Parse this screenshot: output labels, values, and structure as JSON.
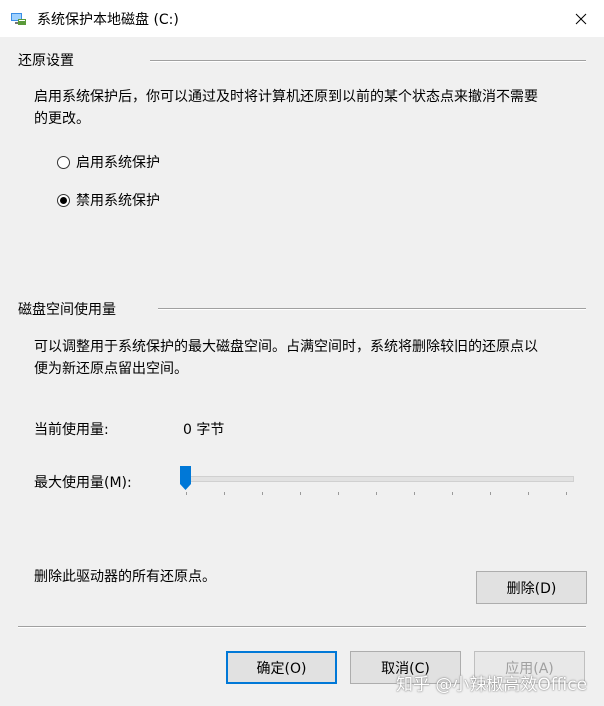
{
  "window": {
    "title": "系统保护本地磁盘 (C:)"
  },
  "restore": {
    "group_label": "还原设置",
    "description_line1": "启用系统保护后，你可以通过及时将计算机还原到以前的某个状态点来撤消不需要",
    "description_line2": "的更改。",
    "options": [
      {
        "label": "启用系统保护",
        "checked": false
      },
      {
        "label": "禁用系统保护",
        "checked": true
      }
    ]
  },
  "disk": {
    "group_label": "磁盘空间使用量",
    "description_line1": "可以调整用于系统保护的最大磁盘空间。占满空间时，系统将删除较旧的还原点以",
    "description_line2": "便为新还原点留出空间。",
    "current_usage_label": "当前使用量:",
    "current_usage_value": "0 字节",
    "max_usage_label": "最大使用量(M):",
    "max_usage_slider_fraction": 0
  },
  "delete": {
    "text": "删除此驱动器的所有还原点。",
    "button_label": "删除(D)"
  },
  "footer": {
    "ok_label": "确定(O)",
    "cancel_label": "取消(C)",
    "apply_label": "应用(A)"
  },
  "watermark": "知乎 @小辣椒高效Office",
  "colors": {
    "accent": "#0078d7",
    "background": "#f0f0f0"
  }
}
